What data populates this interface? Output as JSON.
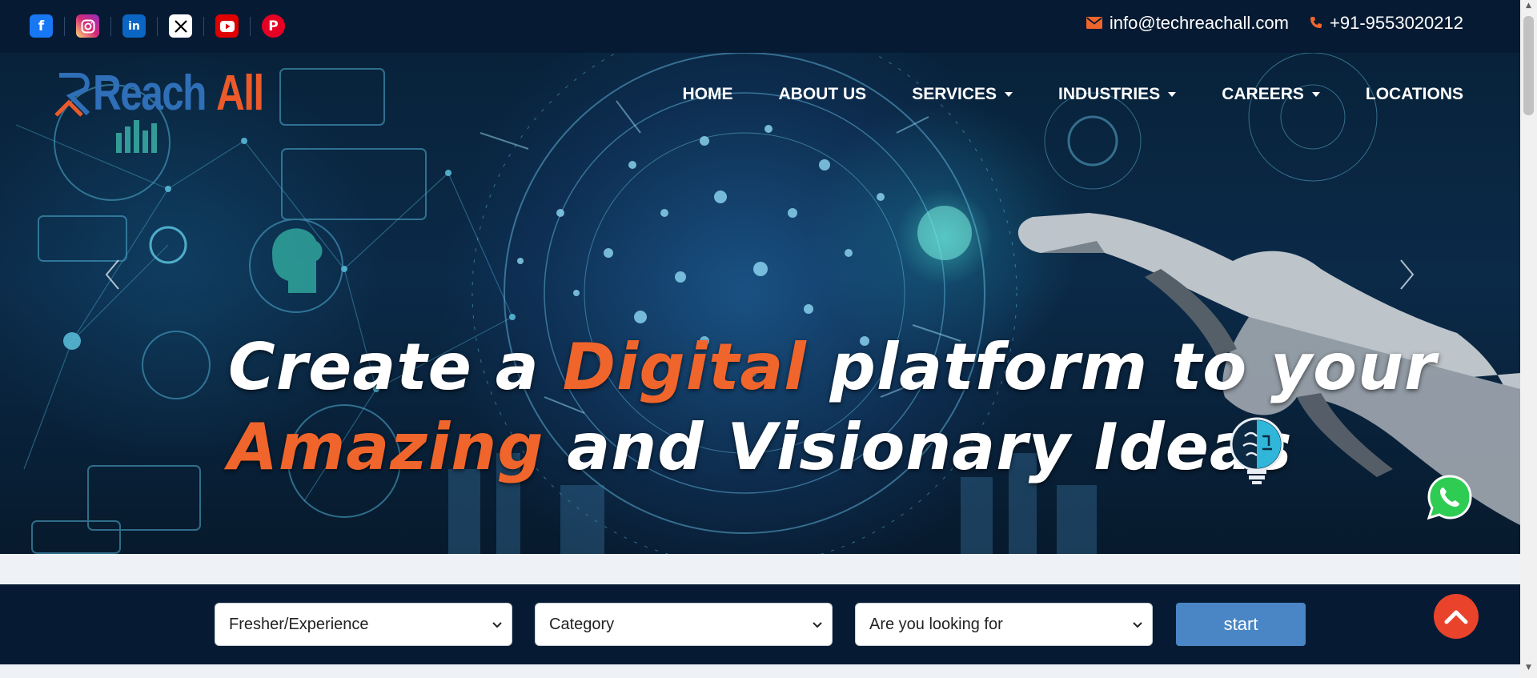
{
  "topbar": {
    "social": [
      {
        "icon": "facebook-icon",
        "glyph": "f",
        "color": "#1877f2"
      },
      {
        "icon": "instagram-icon",
        "glyph": "◎",
        "color": "#d6249f"
      },
      {
        "icon": "linkedin-icon",
        "glyph": "in",
        "color": "#0a66c2"
      },
      {
        "icon": "x-twitter-icon",
        "glyph": "𝕏",
        "color": "#000000"
      },
      {
        "icon": "youtube-icon",
        "glyph": "▶",
        "color": "#ff0000"
      },
      {
        "icon": "pinterest-icon",
        "glyph": "P",
        "color": "#e60023"
      }
    ],
    "email": "info@techreachall.com",
    "phone": "+91-9553020212",
    "email_icon": "envelope-icon",
    "phone_icon": "phone-icon"
  },
  "brand": {
    "part1": "Reach",
    "part2": "All"
  },
  "nav": {
    "home": "HOME",
    "about": "ABOUT US",
    "services": "SERVICES",
    "industries": "INDUSTRIES",
    "careers": "CAREERS",
    "locations": "LOCATIONS"
  },
  "hero": {
    "line1_a": "Create a ",
    "line1_highlight": "Digital",
    "line1_b": " platform to your",
    "line2_highlight": "Amazing",
    "line2_b": " and Visionary Ideas",
    "prev_icon": "chevron-left-icon",
    "next_icon": "chevron-right-icon",
    "highlight_color": "#f0652b"
  },
  "search": {
    "experience": "Fresher/Experience",
    "category": "Category",
    "looking_for": "Are you looking for",
    "start": "start"
  },
  "colors": {
    "navy": "#061b33",
    "accent": "#ec5a2a",
    "button": "#4a86c6"
  }
}
